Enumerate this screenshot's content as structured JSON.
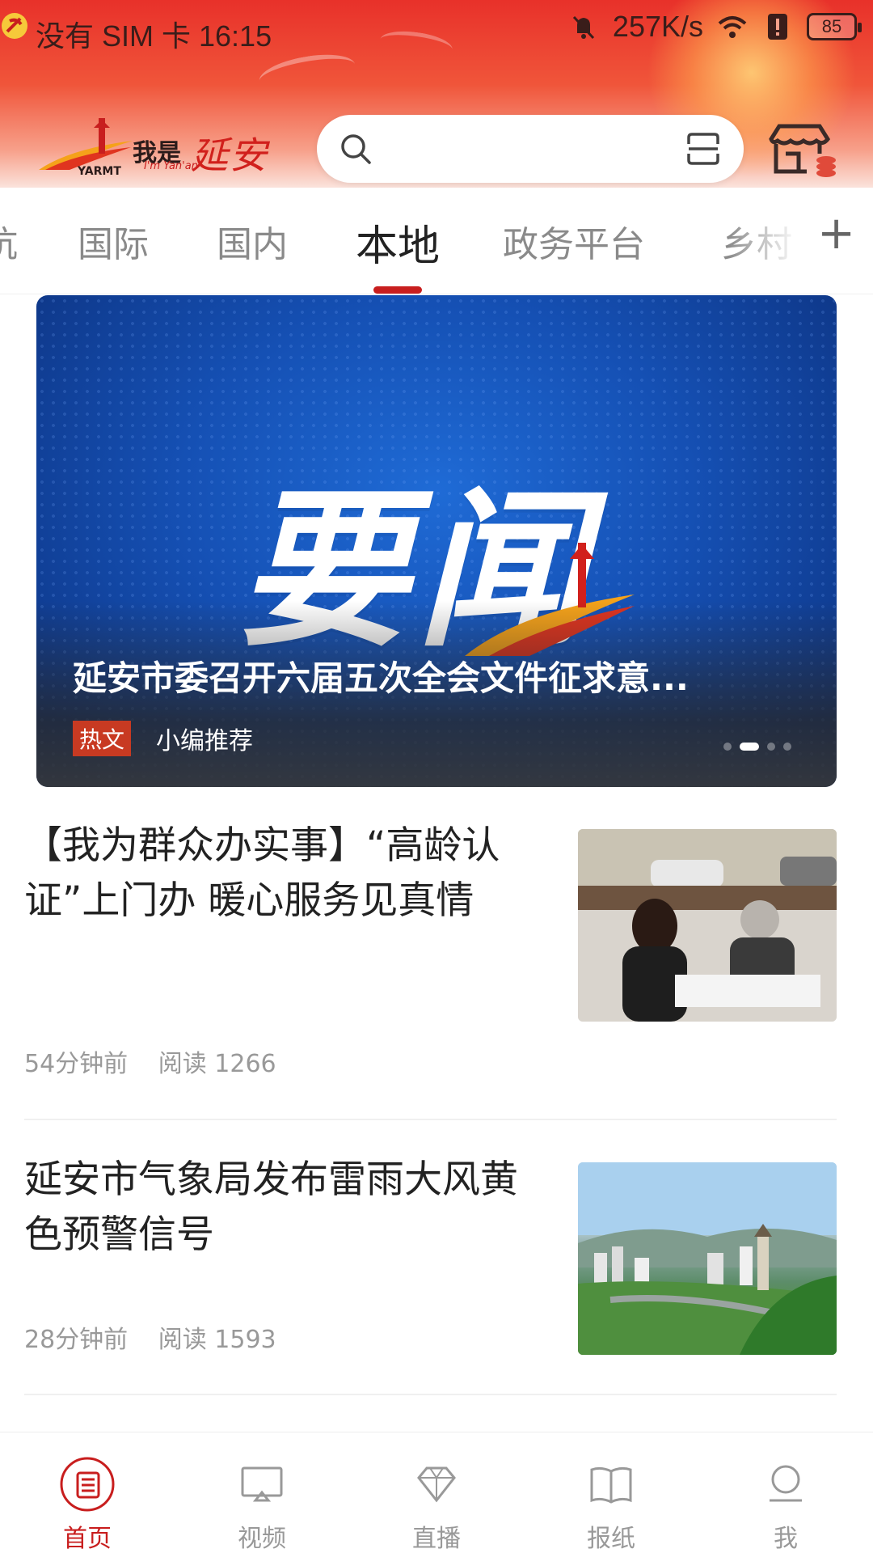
{
  "status_bar": {
    "carrier_time": "没有 SIM 卡 16:15",
    "net_speed": "257K/s",
    "battery": "85"
  },
  "header": {
    "logo": {
      "cn": "我是",
      "script": "延安",
      "sub": "YARMT",
      "sub2": "I'm Yan'an"
    },
    "search_placeholder": ""
  },
  "tabs": [
    {
      "label": "抗",
      "active": false
    },
    {
      "label": "国际",
      "active": false
    },
    {
      "label": "国内",
      "active": false
    },
    {
      "label": "本地",
      "active": true
    },
    {
      "label": "政务平台",
      "active": false
    },
    {
      "label": "乡村",
      "active": false
    }
  ],
  "tab_add": "+",
  "banner": {
    "image_text": "要闻",
    "title": "延安市委召开六届五次全会文件征求意...",
    "tag": "热文",
    "tag2": "小编推荐",
    "pages": 4,
    "current_page": 1
  },
  "news": [
    {
      "title": "【我为群众办实事】“高龄认证”上门办  暖心服务见真情",
      "time": "54分钟前",
      "reads": "阅读 1266"
    },
    {
      "title": "延安市气象局发布雷雨大风黄色预警信号",
      "time": "28分钟前",
      "reads": "阅读 1593"
    }
  ],
  "bottom_nav": [
    {
      "label": "首页",
      "icon": "newspaper-icon",
      "active": true
    },
    {
      "label": "视频",
      "icon": "tv-icon",
      "active": false
    },
    {
      "label": "直播",
      "icon": "diamond-icon",
      "active": false
    },
    {
      "label": "报纸",
      "icon": "book-icon",
      "active": false
    },
    {
      "label": "我",
      "icon": "user-icon",
      "active": false
    }
  ],
  "colors": {
    "accent": "#c81e1e",
    "header_top": "#e8312a",
    "banner_blue": "#1550b4"
  }
}
